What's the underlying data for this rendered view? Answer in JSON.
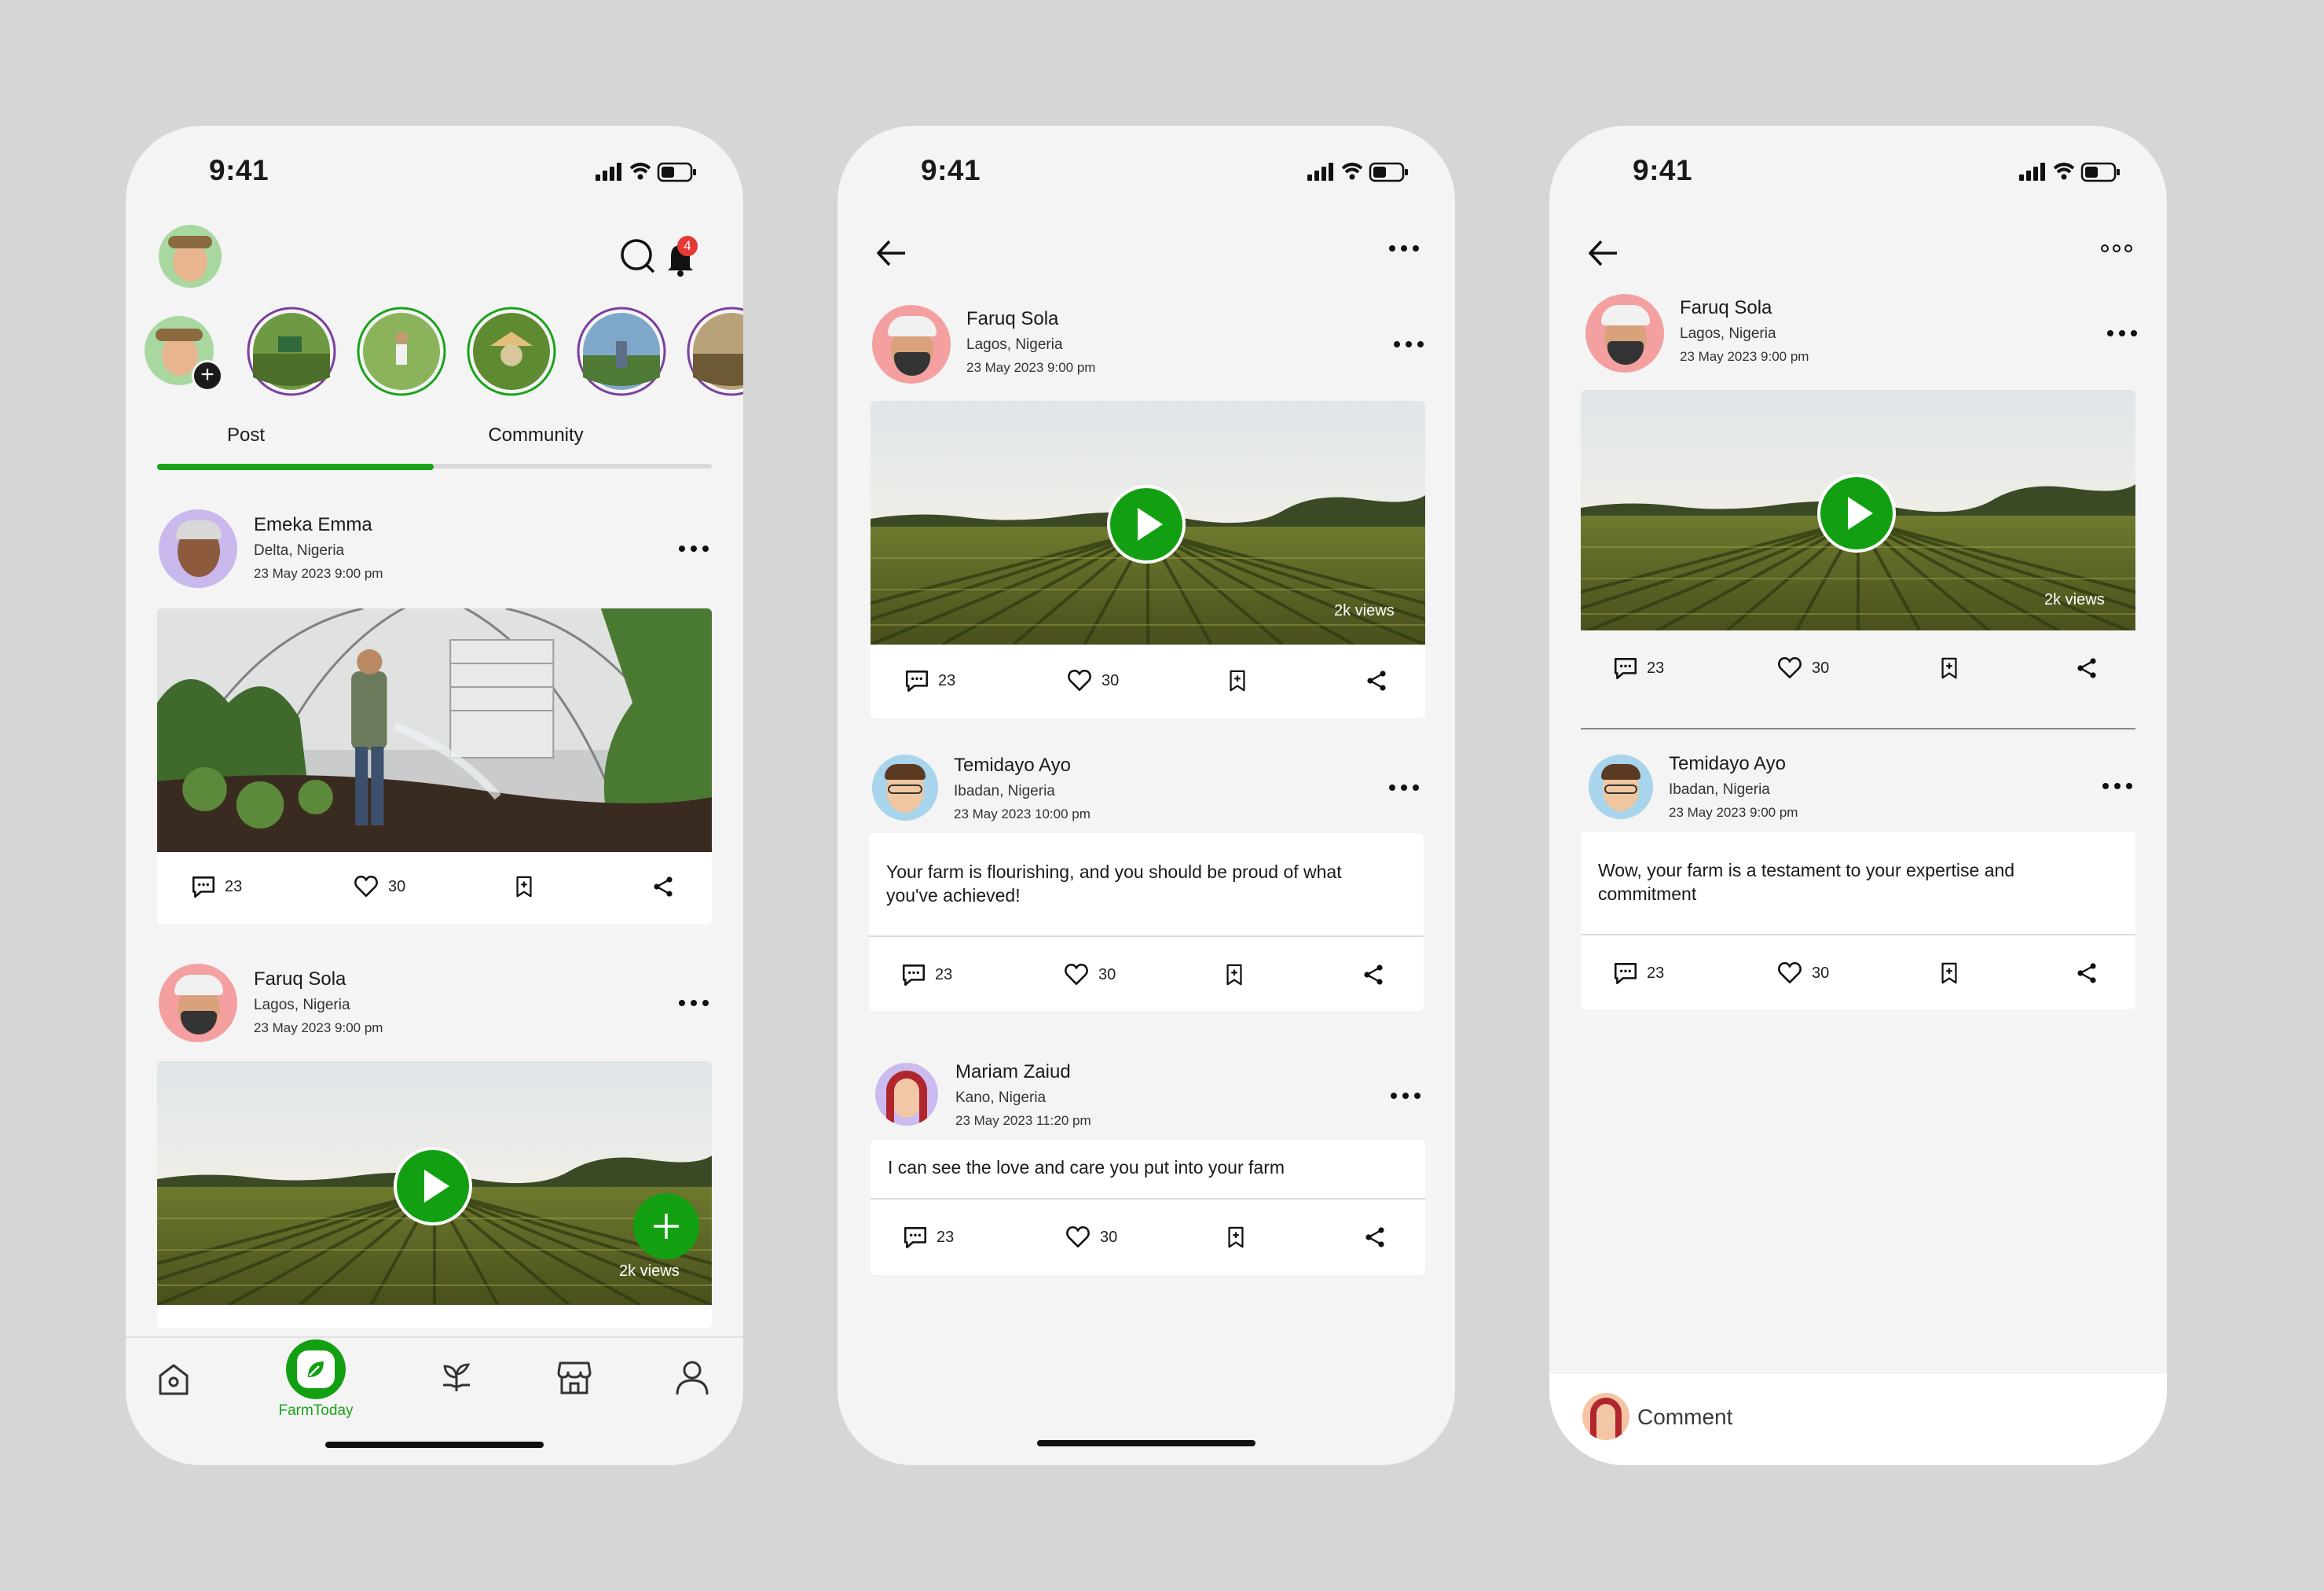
{
  "status": {
    "time": "9:41"
  },
  "feed": {
    "notification_count": "4",
    "tabs": [
      {
        "label": "Post"
      },
      {
        "label": "Community"
      }
    ],
    "posts": [
      {
        "name": "Emeka Emma",
        "location": "Delta, Nigeria",
        "date": "23 May 2023 9:00 pm",
        "comments": "23",
        "likes": "30"
      },
      {
        "name": "Faruq Sola",
        "location": "Lagos, Nigeria",
        "date": "23 May 2023 9:00 pm",
        "views": "2k views"
      }
    ],
    "nav": {
      "active_label": "FarmToday"
    }
  },
  "detail": {
    "post": {
      "name": "Faruq Sola",
      "location": "Lagos, Nigeria",
      "date": "23 May 2023 9:00 pm",
      "views": "2k views",
      "comments": "23",
      "likes": "30"
    },
    "comments": [
      {
        "name": "Temidayo Ayo",
        "location": "Ibadan, Nigeria",
        "date": "23 May 2023 10:00 pm",
        "text": "Your farm is flourishing, and you should be proud of what you've achieved!",
        "comments": "23",
        "likes": "30"
      },
      {
        "name": "Mariam Zaiud",
        "location": "Kano, Nigeria",
        "date": "23 May 2023 11:20 pm",
        "text": "I can see the love and care you put into your farm",
        "comments": "23",
        "likes": "30"
      }
    ]
  },
  "comment_screen": {
    "post": {
      "name": "Faruq Sola",
      "location": "Lagos, Nigeria",
      "date": "23 May 2023 9:00 pm",
      "views": "2k views",
      "comments": "23",
      "likes": "30"
    },
    "comment": {
      "name": "Temidayo Ayo",
      "location": "Ibadan, Nigeria",
      "date": "23 May 2023 9:00 pm",
      "text": "Wow, your farm is a testament to your expertise and commitment",
      "comments": "23",
      "likes": "30"
    },
    "input_placeholder": "Comment"
  },
  "colors": {
    "accent": "#1aa31a",
    "badge": "#e53935",
    "background": "#d6d6d6",
    "screen": "#f4f4f4"
  }
}
